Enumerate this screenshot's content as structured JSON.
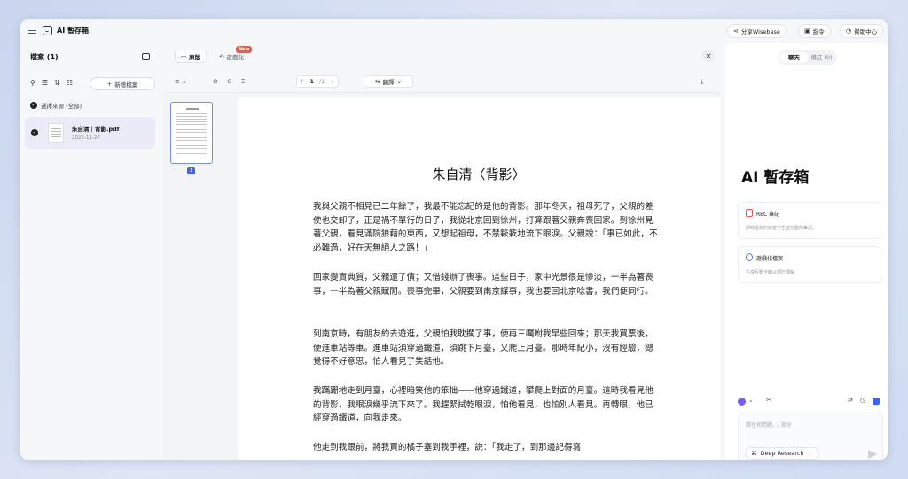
{
  "app": {
    "title": "AI 暫存箱"
  },
  "header": {
    "share_label": "分享Wisebase",
    "command_label": "指令",
    "help_label": "幫助中心"
  },
  "sidebar": {
    "title": "檔案 (1)",
    "new_file_label": "新增檔案",
    "source_label": "選擇來源 (全部)",
    "files": [
      {
        "name": "朱自清｜背影.pdf",
        "date": "2025-11-27"
      }
    ]
  },
  "viewer": {
    "tab_original": "原版",
    "tab_game": "遊戲化",
    "new_badge": "New",
    "page_current": "1",
    "page_total": "/1",
    "translate_label": "翻譯",
    "thumb_page_num": "1",
    "doc_title": "朱自清〈背影〉",
    "paragraphs": [
      "我與父親不相見已二年餘了，我最不能忘記的是他的背影。那年冬天，祖母死了，父親的差使也交卸了，正是禍不單行的日子，我從北京回到徐州，打算跟著父親奔喪回家。到徐州見著父親，看見滿院狼藉的東西，又想起祖母，不禁簌簌地流下眼淚。父親說：「事已如此，不必難過，好在天無絕人之路！」",
      "回家變賣典質，父親還了債；又借錢辦了喪事。這些日子，家中光景很是慘淡，一半為著喪事，一半為著父親賦閒。喪事完畢，父親要到南京謀事，我也要回北京唸書，我們便同行。",
      "到南京時，有朋友約去遊逛，父親怕我耽擱了事，便再三囑咐我早些回來；那天我買票後，便進車站等車。進車站須穿過鐵道，須跳下月臺，又爬上月臺。那時年紀小，沒有經驗，總覺得不好意思，怕人看見了笑話他。",
      "我蹣跚地走到月臺，心裡暗笑他的笨拙——他穿過鐵道，攀爬上對面的月臺。這時我看見他的背影，我眼淚幾乎流下來了。我趕緊拭乾眼淚，怕他看見，也怕別人看見。再轉眼，他已經穿過鐵道，向我走來。",
      "他走到我跟前，將我買的橘子塞到我手裡，說：「我走了，到那邊記得寫"
    ]
  },
  "chat": {
    "tab_chat": "聊天",
    "tab_notes": "備註 (0)",
    "heading": "AI 暫存箱",
    "cards": [
      {
        "title": "REC 筆記",
        "desc": "即時從您的錄音中生成完整的筆記。"
      },
      {
        "title": "遊戲化檔案",
        "desc": "生成互動卡範以便於理解"
      }
    ],
    "input_placeholder": "關住何問題，/ 指令",
    "deep_research_label": "Deep Research"
  }
}
